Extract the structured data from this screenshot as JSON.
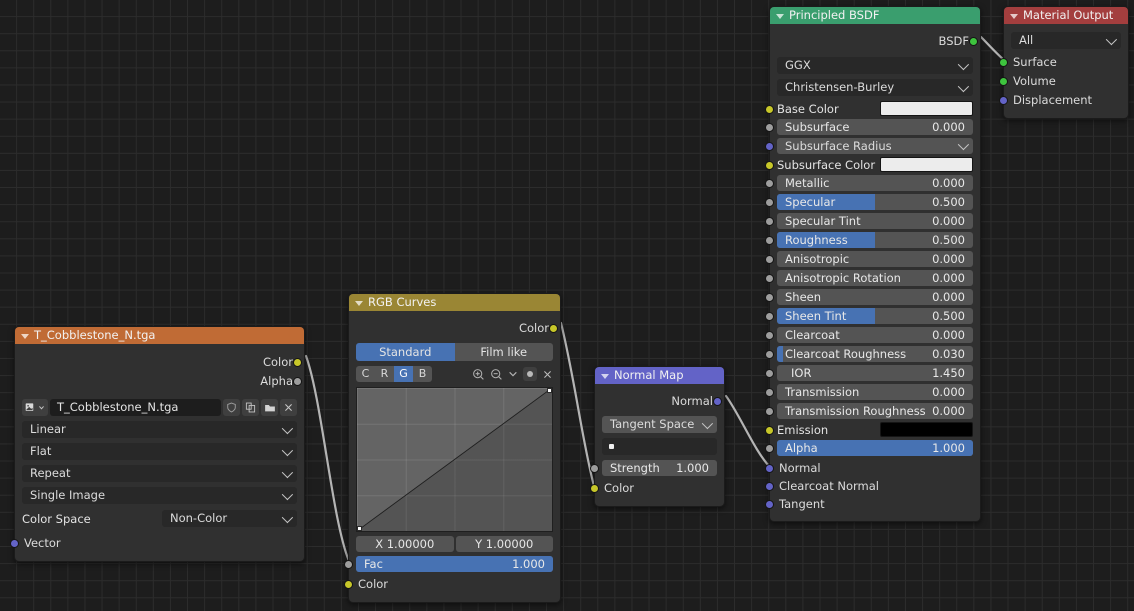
{
  "app": {
    "editor": "shader-node-editor",
    "background": "#1d1d1d",
    "grid_color": "#2c2c2c"
  },
  "colors": {
    "socket_color": "#c7c729",
    "socket_shader": "#3ec43e",
    "socket_vector": "#6363c7",
    "socket_value": "#9d9d9d",
    "accent_blue": "#4772b3",
    "header_texture": "#c06b35",
    "header_curves": "#9a8634",
    "header_vector": "#6363c7",
    "header_shader": "#3a9e6e",
    "header_output": "#a33e3e",
    "link_color": "#b4b4b4"
  },
  "nodes": {
    "image_texture": {
      "title": "T_Cobblestone_N.tga",
      "header_color": "#c06b35",
      "outputs": [
        {
          "label": "Color",
          "socket": "color"
        },
        {
          "label": "Alpha",
          "socket": "value"
        }
      ],
      "datablock": {
        "browse_icon": "image-datablock-icon",
        "name": "T_Cobblestone_N.tga",
        "buttons": [
          "shield-fake-user-icon",
          "new-copy-icon",
          "open-folder-icon",
          "unlink-x-icon"
        ]
      },
      "dropdowns": [
        {
          "name": "interpolation",
          "value": "Linear"
        },
        {
          "name": "projection",
          "value": "Flat"
        },
        {
          "name": "extension",
          "value": "Repeat"
        },
        {
          "name": "source",
          "value": "Single Image"
        }
      ],
      "color_space": {
        "label": "Color Space",
        "value": "Non-Color"
      },
      "inputs": [
        {
          "label": "Vector",
          "socket": "vector"
        }
      ]
    },
    "rgb_curves": {
      "title": "RGB Curves",
      "header_color": "#9a8634",
      "outputs": [
        {
          "label": "Color",
          "socket": "color"
        }
      ],
      "tonemap_tabs": [
        {
          "label": "Standard",
          "active": true
        },
        {
          "label": "Film like",
          "active": false
        }
      ],
      "channels": [
        {
          "label": "C",
          "active": false
        },
        {
          "label": "R",
          "active": false
        },
        {
          "label": "G",
          "active": true
        },
        {
          "label": "B",
          "active": false
        }
      ],
      "tool_icons": [
        "zoom-in-icon",
        "zoom-out-icon",
        "chevron-down-icon",
        "clipping-dot-icon",
        "delete-x-icon"
      ],
      "curve": {
        "x_label": "X 1.00000",
        "y_label": "Y 1.00000"
      },
      "inputs": [
        {
          "label": "Fac",
          "value": "1.000",
          "fill": 100,
          "socket": "value"
        },
        {
          "label": "Color",
          "socket": "color"
        }
      ]
    },
    "normal_map": {
      "title": "Normal Map",
      "header_color": "#6363c7",
      "outputs": [
        {
          "label": "Normal",
          "socket": "vector"
        }
      ],
      "space": "Tangent Space",
      "uv_map": "",
      "strength": {
        "label": "Strength",
        "value": "1.000",
        "socket": "value"
      },
      "color_input": {
        "label": "Color",
        "socket": "color"
      }
    },
    "principled_bsdf": {
      "title": "Principled BSDF",
      "header_color": "#3a9e6e",
      "outputs": [
        {
          "label": "BSDF",
          "socket": "shader"
        }
      ],
      "distribution": "GGX",
      "subsurface_method": "Christensen-Burley",
      "properties": [
        {
          "label": "Base Color",
          "type": "color",
          "swatch": "#ececec",
          "socket": "color"
        },
        {
          "label": "Subsurface",
          "type": "slider",
          "value": "0.000",
          "fill": 0,
          "socket": "value"
        },
        {
          "label": "Subsurface Radius",
          "type": "dropdown",
          "socket": "vector"
        },
        {
          "label": "Subsurface Color",
          "type": "color",
          "swatch": "#ececec",
          "socket": "color"
        },
        {
          "label": "Metallic",
          "type": "slider",
          "value": "0.000",
          "fill": 0,
          "socket": "value"
        },
        {
          "label": "Specular",
          "type": "slider",
          "value": "0.500",
          "fill": 50,
          "socket": "value"
        },
        {
          "label": "Specular Tint",
          "type": "slider",
          "value": "0.000",
          "fill": 0,
          "socket": "value"
        },
        {
          "label": "Roughness",
          "type": "slider",
          "value": "0.500",
          "fill": 50,
          "socket": "value"
        },
        {
          "label": "Anisotropic",
          "type": "slider",
          "value": "0.000",
          "fill": 0,
          "socket": "value"
        },
        {
          "label": "Anisotropic Rotation",
          "type": "slider",
          "value": "0.000",
          "fill": 0,
          "socket": "value"
        },
        {
          "label": "Sheen",
          "type": "slider",
          "value": "0.000",
          "fill": 0,
          "socket": "value"
        },
        {
          "label": "Sheen Tint",
          "type": "slider",
          "value": "0.500",
          "fill": 50,
          "socket": "value"
        },
        {
          "label": "Clearcoat",
          "type": "slider",
          "value": "0.000",
          "fill": 0,
          "socket": "value"
        },
        {
          "label": "Clearcoat Roughness",
          "type": "slider",
          "value": "0.030",
          "fill": 3,
          "socket": "value"
        },
        {
          "label": "IOR",
          "type": "slider",
          "value": "1.450",
          "fill": 0,
          "socket": "value"
        },
        {
          "label": "Transmission",
          "type": "slider",
          "value": "0.000",
          "fill": 0,
          "socket": "value"
        },
        {
          "label": "Transmission Roughness",
          "type": "slider",
          "value": "0.000",
          "fill": 0,
          "socket": "value"
        },
        {
          "label": "Emission",
          "type": "color",
          "swatch": "#000000",
          "socket": "color"
        },
        {
          "label": "Alpha",
          "type": "slider",
          "value": "1.000",
          "fill": 100,
          "socket": "value"
        },
        {
          "label": "Normal",
          "type": "plain",
          "socket": "vector"
        },
        {
          "label": "Clearcoat Normal",
          "type": "plain",
          "socket": "vector"
        },
        {
          "label": "Tangent",
          "type": "plain",
          "socket": "vector"
        }
      ]
    },
    "material_output": {
      "title": "Material Output",
      "header_color": "#a33e3e",
      "target": "All",
      "inputs": [
        {
          "label": "Surface",
          "socket": "shader"
        },
        {
          "label": "Volume",
          "socket": "shader"
        },
        {
          "label": "Displacement",
          "socket": "vector"
        }
      ]
    }
  }
}
